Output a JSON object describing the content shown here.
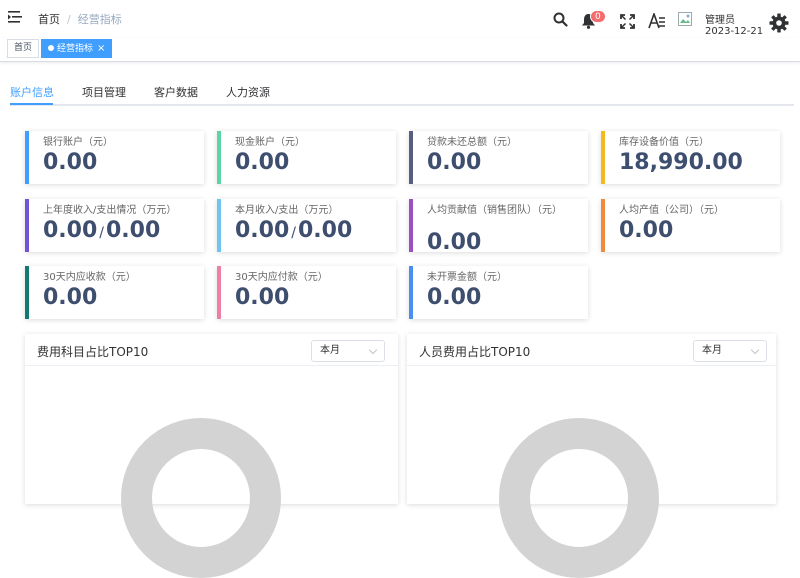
{
  "header": {
    "breadcrumb": {
      "home": "首页",
      "separator": "/",
      "current": "经营指标"
    },
    "notification_count": "0",
    "user": {
      "name": "管理员",
      "date": "2023-12-21"
    },
    "icons": [
      "menu-fold-icon",
      "search-icon",
      "bell-icon",
      "fullscreen-icon",
      "font-size-icon",
      "avatar-image",
      "gear-icon"
    ]
  },
  "tags": [
    {
      "label": "首页",
      "active": false
    },
    {
      "label": "经营指标",
      "active": true,
      "close": "×"
    }
  ],
  "tabs": [
    "账户信息",
    "项目管理",
    "客户数据",
    "人力资源"
  ],
  "cards": [
    {
      "label": "银行账户（元）",
      "value": "0.00",
      "color": "#409eff"
    },
    {
      "label": "现金账户（元）",
      "value": "0.00",
      "color": "#5ed3a4"
    },
    {
      "label": "贷款未还总额（元）",
      "value": "0.00",
      "color": "#556080"
    },
    {
      "label": "库存设备价值（元）",
      "value": "18,990.00",
      "color": "#f5b81f"
    },
    {
      "label": "上年度收入/支出情况（万元）",
      "value": "0.00",
      "value2": "0.00",
      "color": "#7153d6"
    },
    {
      "label": "本月收入/支出（万元）",
      "value": "0.00",
      "value2": "0.00",
      "color": "#6ec6f0"
    },
    {
      "label": "人均贡献值（销售团队）（元）",
      "value": "0.00",
      "color": "#9c4fc0"
    },
    {
      "label": "人均产值（公司）（元）",
      "value": "0.00",
      "color": "#f08a3e"
    },
    {
      "label": "30天内应收款（元）",
      "value": "0.00",
      "color": "#127a6e"
    },
    {
      "label": "30天内应付款（元）",
      "value": "0.00",
      "color": "#ee7fa6"
    },
    {
      "label": "未开票金额（元）",
      "value": "0.00",
      "color": "#4a8ef0"
    }
  ],
  "panels": [
    {
      "title": "费用科目占比TOP10",
      "select": "本月"
    },
    {
      "title": "人员费用占比TOP10",
      "select": "本月"
    }
  ]
}
